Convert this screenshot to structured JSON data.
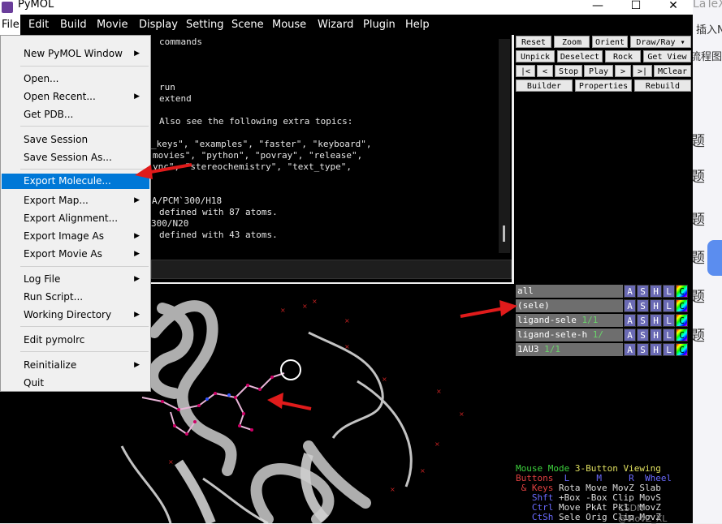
{
  "window": {
    "title": "PyMOL",
    "minimize": "—",
    "maximize": "☐",
    "close": "✕"
  },
  "menubar": [
    "File",
    "Edit",
    "Build",
    "Movie",
    "Display",
    "Setting",
    "Scene",
    "Mouse",
    "Wizard",
    "Plugin",
    "Help"
  ],
  "console_lines": [
    "commands",
    "run",
    "extend",
    "Also see the following extra topics:",
    "_keys\", \"examples\", \"faster\", \"keyboard\",",
    "movies\", \"python\", \"povray\", \"release\",",
    "ync\", \"stereochemistry\", \"text_type\",",
    "A/PCM`300/H18",
    "defined with 87 atoms.",
    "300/N20",
    "defined with 43 atoms."
  ],
  "controls": {
    "row1": [
      "Reset",
      "Zoom",
      "Orient",
      "Draw/Ray ▾"
    ],
    "row2": [
      "Unpick",
      "Deselect",
      "Rock",
      "Get View"
    ],
    "row3": [
      "|<",
      "<",
      "Stop",
      "Play",
      ">",
      ">|",
      "MClear"
    ],
    "row4": [
      "Builder",
      "Properties",
      "Rebuild"
    ]
  },
  "objects": [
    {
      "name": "all",
      "state": ""
    },
    {
      "name": "(sele)",
      "state": ""
    },
    {
      "name": "ligand-sele",
      "state": "1/1"
    },
    {
      "name": "ligand-sele-h",
      "state": "1/"
    },
    {
      "name": "1AU3",
      "state": "1/1"
    }
  ],
  "object_buttons": [
    "A",
    "S",
    "H",
    "L",
    "C"
  ],
  "mouse_panel": {
    "l1a": "Mouse Mode ",
    "l1b": "3-Button Viewing",
    "l2a": "Buttons ",
    "l2b": " L     M     R  Wheel",
    "l3a": " & Keys ",
    "l3b": "Rota Move MovZ Slab",
    "l4a": "   Shft ",
    "l4b": "+Box -Box Clip MovS",
    "l5a": "   Ctrl ",
    "l5b": "Move PkAt Pk1  MovZ",
    "l6a": "   CtSh ",
    "l6b": "Sele Orig Clip MovZ",
    "watermark": "CSDN @MovZ_XL"
  },
  "file_menu": [
    {
      "label": "New PyMOL Window",
      "sub": true
    },
    {
      "label": "Open...",
      "sub": false
    },
    {
      "label": "Open Recent...",
      "sub": true
    },
    {
      "label": "Get PDB...",
      "sub": false
    },
    {
      "label": "Save Session",
      "sub": false
    },
    {
      "label": "Save Session As...",
      "sub": false
    },
    {
      "label": "Export Molecule...",
      "sub": false,
      "highlighted": true
    },
    {
      "label": "Export Map...",
      "sub": true
    },
    {
      "label": "Export Alignment...",
      "sub": false
    },
    {
      "label": "Export Image As",
      "sub": true
    },
    {
      "label": "Export Movie As",
      "sub": true
    },
    {
      "label": "Log File",
      "sub": true
    },
    {
      "label": "Run Script...",
      "sub": false
    },
    {
      "label": "Working Directory",
      "sub": true
    },
    {
      "label": "Edit pymolrc",
      "sub": false
    },
    {
      "label": "Reinitialize",
      "sub": true
    },
    {
      "label": "Quit",
      "sub": false
    }
  ],
  "background_app": [
    "LaTeX",
    "插入N",
    "流程图",
    "题",
    "题",
    "题",
    "题",
    "题",
    "题"
  ],
  "colors": {
    "highlight": "#0078d7",
    "annotation_arrow": "#e01b1b",
    "object_button": "#6a6ab4"
  }
}
